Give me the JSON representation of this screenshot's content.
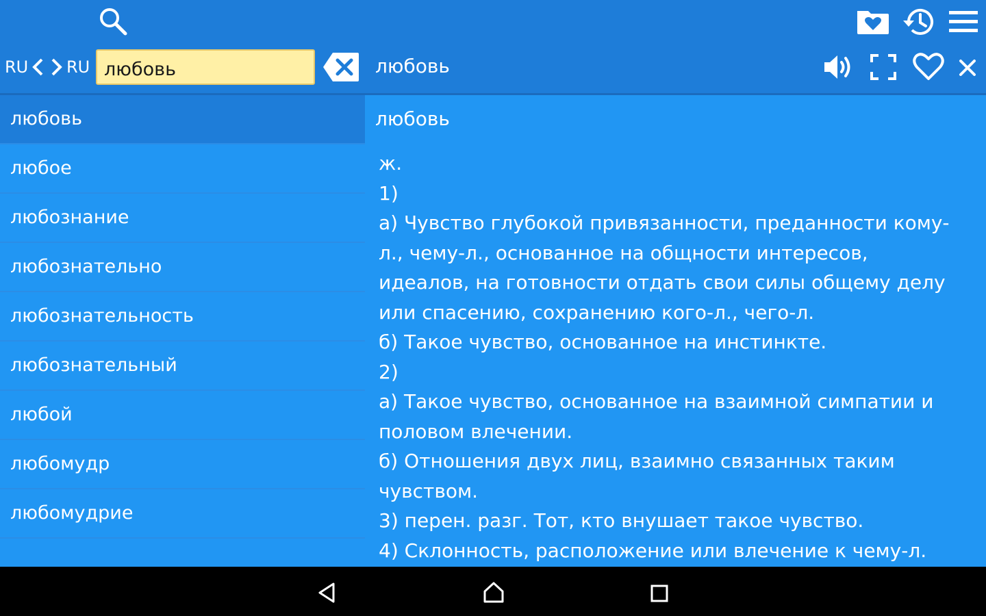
{
  "toolbar": {
    "icons": [
      "search-icon",
      "favorites-folder-icon",
      "history-icon",
      "menu-icon"
    ],
    "source_lang": "RU",
    "target_lang": "RU"
  },
  "search": {
    "value": "любовь",
    "clear_icon": "backspace-clear-icon"
  },
  "header": {
    "word": "любовь",
    "icons": [
      "speaker-icon",
      "fullscreen-icon",
      "heart-icon",
      "close-icon"
    ]
  },
  "word_list": [
    {
      "label": "любовь",
      "selected": true
    },
    {
      "label": "любое"
    },
    {
      "label": "любознание"
    },
    {
      "label": "любознательно"
    },
    {
      "label": "любознательность"
    },
    {
      "label": "любознательный"
    },
    {
      "label": "любой"
    },
    {
      "label": "любомудр"
    },
    {
      "label": "любомудрие"
    }
  ],
  "article": {
    "headword": "любовь",
    "lines": [
      "ж.",
      "1)",
      "а) Чувство глубокой привязанности, преданности кому-",
      "л., чему-л., основанное на общности интересов,",
      "идеалов, на готовности отдать свои силы общему делу",
      "или спасению, сохранению кого-л., чего-л.",
      "б) Такое чувство, основанное на инстинкте.",
      "2)",
      "а) Такое чувство, основанное на взаимной симпатии и",
      "половом влечении.",
      "б) Отношения двух лиц, взаимно связанных таким",
      "чувством.",
      "3) перен. разг. Тот, кто внушает такое чувство.",
      "4) Склонность, расположение или влечение к чему-л."
    ]
  },
  "navbar": {
    "icons": [
      "back-icon",
      "home-icon",
      "recents-icon"
    ]
  },
  "colors": {
    "toolbar_bg": "#1e7dd9",
    "content_bg": "#2196f3",
    "search_bg": "#fff0a6",
    "nav_bg": "#000000"
  }
}
